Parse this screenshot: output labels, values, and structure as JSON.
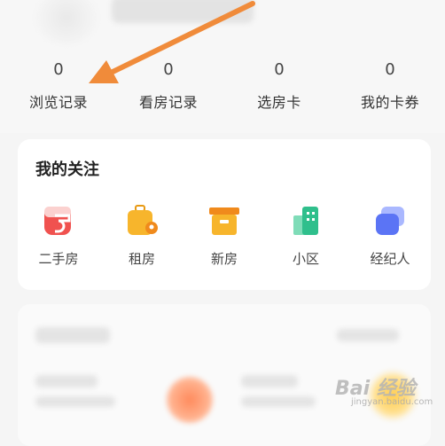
{
  "stats": [
    {
      "value": "0",
      "label": "浏览记录"
    },
    {
      "value": "0",
      "label": "看房记录"
    },
    {
      "value": "0",
      "label": "选房卡"
    },
    {
      "value": "0",
      "label": "我的卡券"
    }
  ],
  "follow": {
    "title": "我的关注",
    "items": [
      {
        "label": "二手房",
        "icon": "second-hand-house-icon",
        "color": "#f0524f"
      },
      {
        "label": "租房",
        "icon": "rent-icon",
        "color": "#f7b52c"
      },
      {
        "label": "新房",
        "icon": "new-house-icon",
        "color": "#f5a623"
      },
      {
        "label": "小区",
        "icon": "community-icon",
        "color": "#2fbf8c"
      },
      {
        "label": "经纪人",
        "icon": "agent-icon",
        "color": "#5b74f5"
      }
    ]
  },
  "watermark": {
    "text": "Bai 经验",
    "sub": "jingyan.baidu.com"
  },
  "annotation_color": "#f08b3a"
}
